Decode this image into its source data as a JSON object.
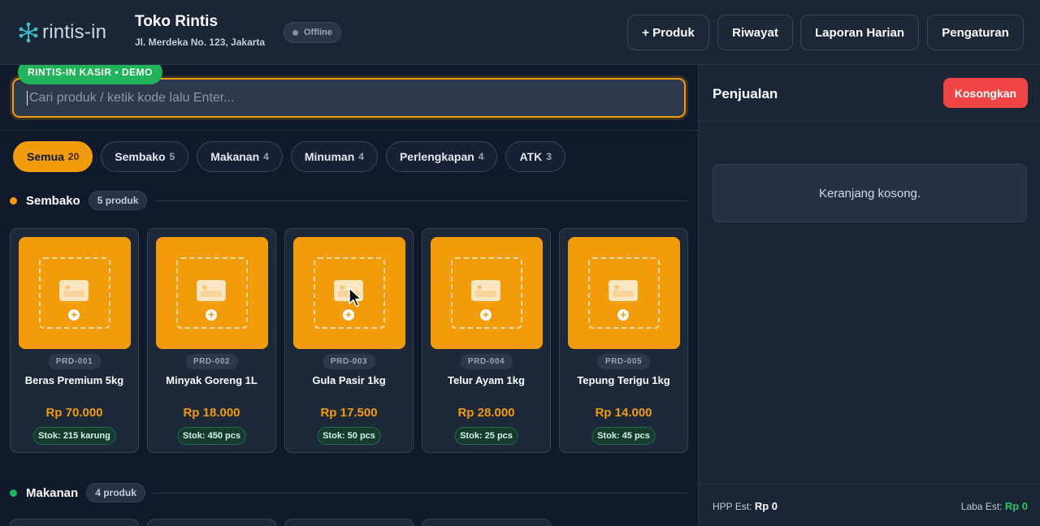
{
  "app": {
    "logo_text": "rintis-in"
  },
  "store": {
    "name": "Toko Rintis",
    "address": "Jl. Merdeka No. 123, Jakarta",
    "status": "Offline"
  },
  "nav": {
    "produk": "+ Produk",
    "riwayat": "Riwayat",
    "laporan": "Laporan Harian",
    "pengaturan": "Pengaturan"
  },
  "demo_badge": "RINTIS-IN KASIR • DEMO",
  "search": {
    "placeholder": "Cari produk / ketik kode lalu Enter..."
  },
  "categories": [
    {
      "label": "Semua",
      "count": "20"
    },
    {
      "label": "Sembako",
      "count": "5"
    },
    {
      "label": "Makanan",
      "count": "4"
    },
    {
      "label": "Minuman",
      "count": "4"
    },
    {
      "label": "Perlengkapan",
      "count": "4"
    },
    {
      "label": "ATK",
      "count": "3"
    }
  ],
  "sections": [
    {
      "title": "Sembako",
      "count": "5 produk",
      "color": "#f39c0b"
    },
    {
      "title": "Makanan",
      "count": "4 produk",
      "color": "#1fb45c"
    }
  ],
  "products": [
    {
      "code": "PRD-001",
      "name": "Beras Premium 5kg",
      "price": "Rp 70.000",
      "stock": "Stok: 215 karung"
    },
    {
      "code": "PRD-002",
      "name": "Minyak Goreng 1L",
      "price": "Rp 18.000",
      "stock": "Stok: 450 pcs"
    },
    {
      "code": "PRD-003",
      "name": "Gula Pasir 1kg",
      "price": "Rp 17.500",
      "stock": "Stok: 50 pcs"
    },
    {
      "code": "PRD-004",
      "name": "Telur Ayam 1kg",
      "price": "Rp 28.000",
      "stock": "Stok: 25 pcs"
    },
    {
      "code": "PRD-005",
      "name": "Tepung Terigu 1kg",
      "price": "Rp 14.000",
      "stock": "Stok: 45 pcs"
    }
  ],
  "cart": {
    "title": "Penjualan",
    "clear_label": "Kosongkan",
    "empty_text": "Keranjang kosong.",
    "hpp_label": "HPP Est:",
    "hpp_value": "Rp 0",
    "laba_label": "Laba Est:",
    "laba_value": "Rp 0"
  },
  "colors": {
    "accent": "#f39c0b",
    "success": "#1fb45c",
    "danger": "#ef4444",
    "background": "#111a2b"
  }
}
